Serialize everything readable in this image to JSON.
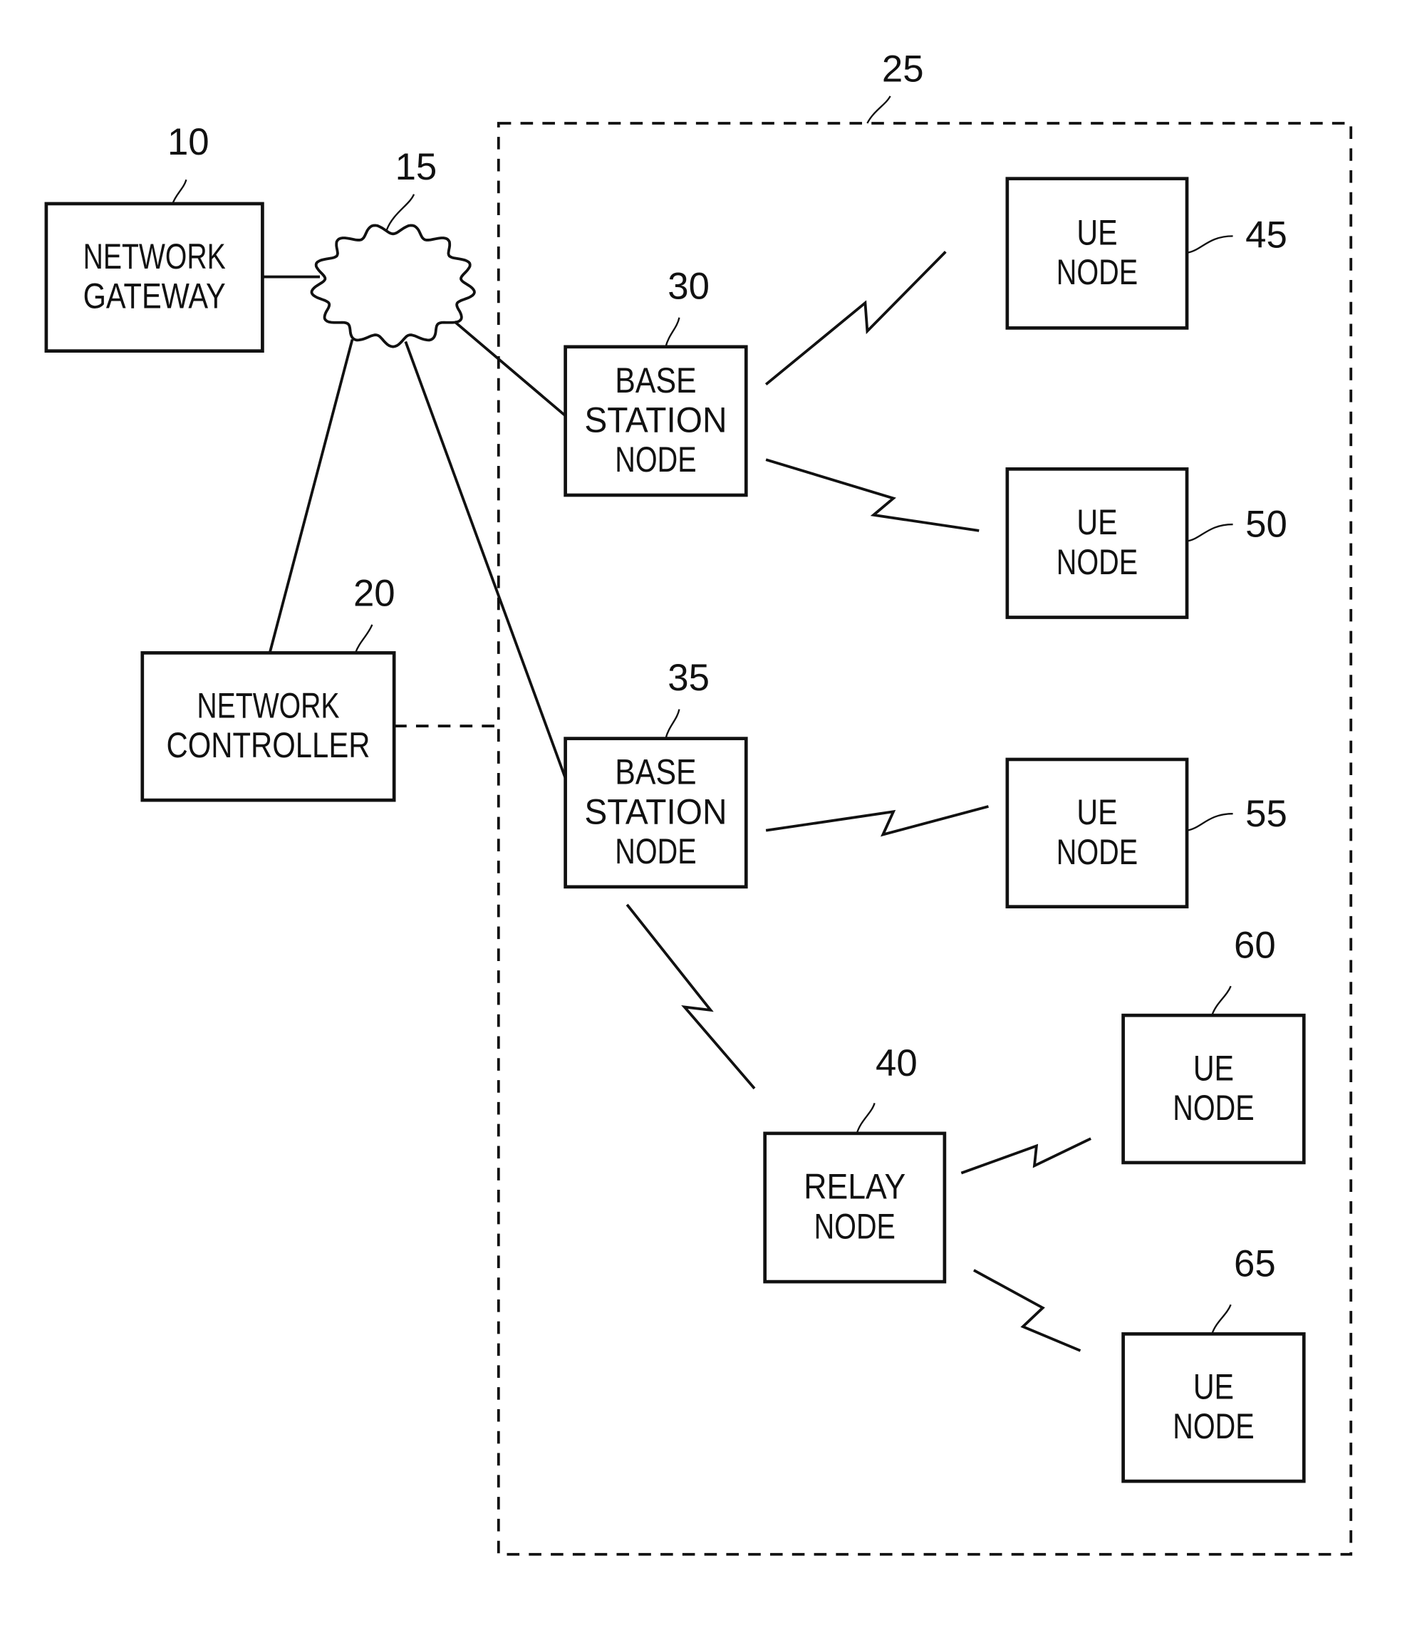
{
  "figure": {
    "region": {
      "ref": "25"
    },
    "cloud": {
      "ref": "15"
    },
    "nodes": [
      {
        "id": "gateway",
        "ref": "10",
        "lines": [
          "NETWORK",
          "GATEWAY"
        ]
      },
      {
        "id": "controller",
        "ref": "20",
        "lines": [
          "NETWORK",
          "CONTROLLER"
        ]
      },
      {
        "id": "bs30",
        "ref": "30",
        "lines": [
          "BASE",
          "STATION",
          "NODE"
        ]
      },
      {
        "id": "bs35",
        "ref": "35",
        "lines": [
          "BASE",
          "STATION",
          "NODE"
        ]
      },
      {
        "id": "relay",
        "ref": "40",
        "lines": [
          "RELAY",
          "NODE"
        ]
      },
      {
        "id": "ue45",
        "ref": "45",
        "lines": [
          "UE",
          "NODE"
        ]
      },
      {
        "id": "ue50",
        "ref": "50",
        "lines": [
          "UE",
          "NODE"
        ]
      },
      {
        "id": "ue55",
        "ref": "55",
        "lines": [
          "UE",
          "NODE"
        ]
      },
      {
        "id": "ue60",
        "ref": "60",
        "lines": [
          "UE",
          "NODE"
        ]
      },
      {
        "id": "ue65",
        "ref": "65",
        "lines": [
          "UE",
          "NODE"
        ]
      }
    ],
    "wired_links": [
      {
        "from": "gateway",
        "to": "cloud"
      },
      {
        "from": "cloud",
        "to": "controller"
      },
      {
        "from": "cloud",
        "to": "bs30"
      },
      {
        "from": "cloud",
        "to": "bs35"
      }
    ],
    "control_links": [
      {
        "from": "controller",
        "to": "region"
      }
    ],
    "wireless_links": [
      {
        "from": "bs30",
        "to": "ue45"
      },
      {
        "from": "bs30",
        "to": "ue50"
      },
      {
        "from": "bs35",
        "to": "ue55"
      },
      {
        "from": "bs35",
        "to": "relay"
      },
      {
        "from": "relay",
        "to": "ue60"
      },
      {
        "from": "relay",
        "to": "ue65"
      }
    ]
  }
}
